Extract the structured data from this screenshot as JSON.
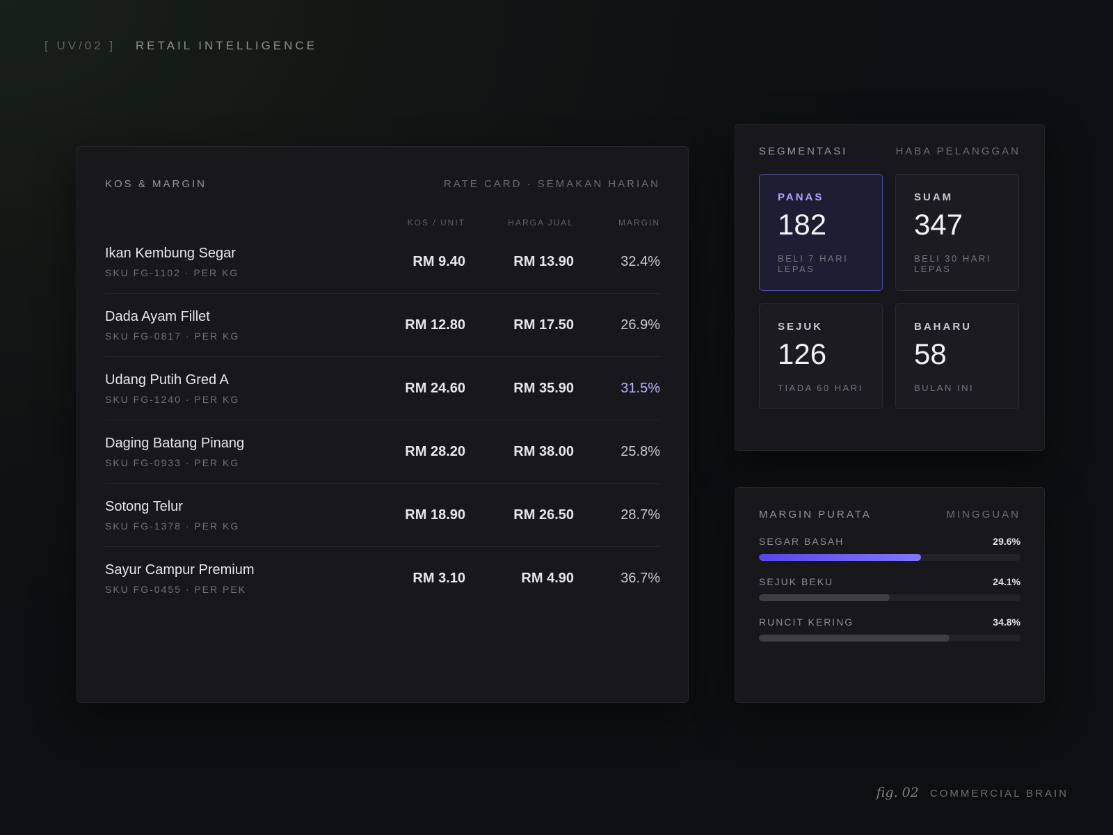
{
  "header": {
    "code": "[ UV/02 ]",
    "title": "RETAIL INTELLIGENCE"
  },
  "kos": {
    "title": "KOS & MARGIN",
    "subtitle": "RATE CARD · SEMAKAN HARIAN",
    "columns": {
      "kos": "KOS / UNIT",
      "harga": "HARGA JUAL",
      "margin": "MARGIN"
    },
    "rows": [
      {
        "name": "Ikan Kembung Segar",
        "sku": "SKU FG-1102 · PER KG",
        "kos": "RM 9.40",
        "harga": "RM 13.90",
        "margin": "32.4%"
      },
      {
        "name": "Dada Ayam Fillet",
        "sku": "SKU FG-0817 · PER KG",
        "kos": "RM 12.80",
        "harga": "RM 17.50",
        "margin": "26.9%"
      },
      {
        "name": "Udang Putih Gred A",
        "sku": "SKU FG-1240 · PER KG",
        "kos": "RM 24.60",
        "harga": "RM 35.90",
        "margin": "31.5%"
      },
      {
        "name": "Daging Batang Pinang",
        "sku": "SKU FG-0933 · PER KG",
        "kos": "RM 28.20",
        "harga": "RM 38.00",
        "margin": "25.8%"
      },
      {
        "name": "Sotong Telur",
        "sku": "SKU FG-1378 · PER KG",
        "kos": "RM 18.90",
        "harga": "RM 26.50",
        "margin": "28.7%"
      },
      {
        "name": "Sayur Campur Premium",
        "sku": "SKU FG-0455 · PER PEK",
        "kos": "RM 3.10",
        "harga": "RM 4.90",
        "margin": "36.7%"
      }
    ],
    "highlight_color": "#b8b4ff"
  },
  "segment": {
    "title": "SEGMENTASI",
    "subtitle": "HABA PELANGGAN",
    "tiles": [
      {
        "name": "PANAS",
        "count": "182",
        "sub": "BELI 7 HARI LEPAS",
        "active": true
      },
      {
        "name": "SUAM",
        "count": "347",
        "sub": "BELI 30 HARI LEPAS"
      },
      {
        "name": "SEJUK",
        "count": "126",
        "sub": "TIADA 60 HARI"
      },
      {
        "name": "BAHARU",
        "count": "58",
        "sub": "BULAN INI"
      }
    ],
    "accent": "#5548e6"
  },
  "margin": {
    "title": "MARGIN PURATA",
    "subtitle": "MINGGUAN",
    "bars": [
      {
        "label": "SEGAR BASAH",
        "value": "29.6%",
        "fill": 0.62,
        "primary": true
      },
      {
        "label": "SEJUK BEKU",
        "value": "24.1%",
        "fill": 0.5
      },
      {
        "label": "RUNCIT KERING",
        "value": "34.8%",
        "fill": 0.73
      }
    ]
  },
  "footer": {
    "fig": "fig. 02",
    "caption": "COMMERCIAL BRAIN"
  }
}
